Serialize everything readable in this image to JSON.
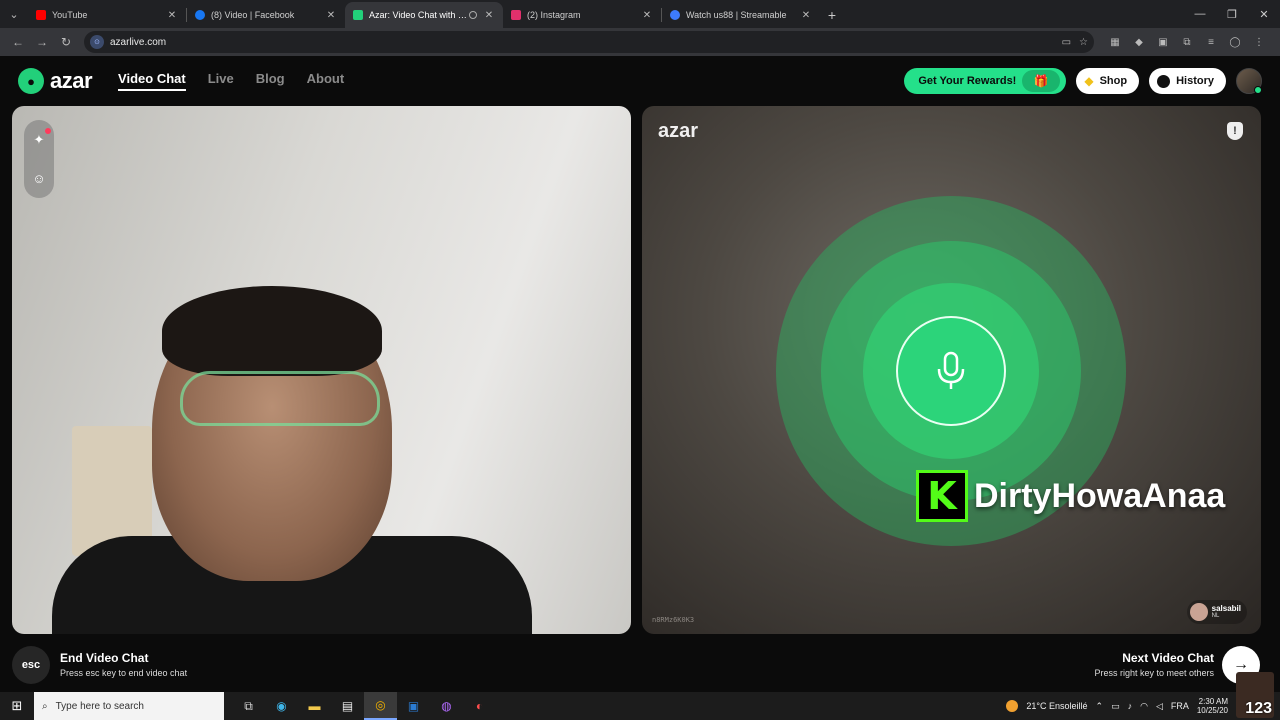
{
  "browser": {
    "tabs": [
      {
        "title": "YouTube",
        "color": "#ff0000",
        "active": false
      },
      {
        "title": "(8) Video | Facebook",
        "color": "#1877f2",
        "active": false
      },
      {
        "title": "Azar: Video Chat with New",
        "color": "#22d07a",
        "active": true
      },
      {
        "title": "(2) Instagram",
        "color": "#e1306c",
        "active": false
      },
      {
        "title": "Watch us88 | Streamable",
        "color": "#3d7bfd",
        "active": false
      }
    ],
    "url": "azarlive.com"
  },
  "azar": {
    "logo": "azar",
    "nav": [
      "Video Chat",
      "Live",
      "Blog",
      "About"
    ],
    "rewards_label": "Get Your Rewards!",
    "shop_label": "Shop",
    "history_label": "History",
    "accent": "#24e08a"
  },
  "remote": {
    "watermark": "azar",
    "overlay_name": "DirtyHowaAnaa",
    "session_id": "n8RMz6K0K3",
    "partner_name": "salsabil",
    "partner_country": "NL"
  },
  "controls": {
    "end_key": "esc",
    "end_title": "End Video Chat",
    "end_sub": "Press esc key to end video chat",
    "next_title": "Next Video Chat",
    "next_sub": "Press right key to meet others"
  },
  "taskbar": {
    "search_placeholder": "Type here to search",
    "weather": "21°C Ensoleillé",
    "lang": "FRA",
    "time": "2:30 AM",
    "date": "10/25/20",
    "overlay_number": "123"
  }
}
